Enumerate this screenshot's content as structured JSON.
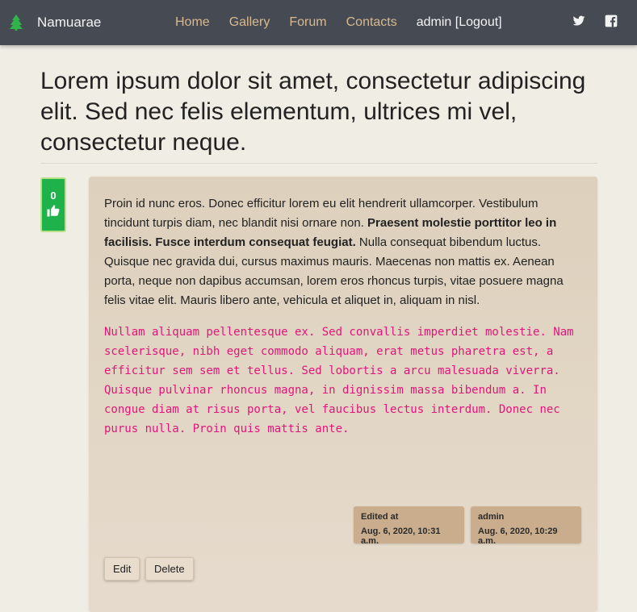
{
  "navbar": {
    "brand": "Namuarae",
    "links": [
      "Home",
      "Gallery",
      "Forum",
      "Contacts"
    ],
    "user_link": "admin [Logout]",
    "socials": [
      "twitter-icon",
      "facebook-icon"
    ],
    "colors": {
      "background": "#464b53",
      "link": "#d8b98f",
      "brand_icon": "#2fb34a"
    }
  },
  "post": {
    "title": "Lorem ipsum dolor sit amet, consectetur adipiscing elit. Sed nec felis elementum, ultrices mi vel, consectetur neque.",
    "votes": "0",
    "body": {
      "text_before_bold": "Proin id nunc eros. Donec efficitur lorem eu elit hendrerit ullamcorper. Vestibulum tincidunt turpis diam, nec blandit nisi ornare non.",
      "bold": "Praesent molestie porttitor leo in facilisis. Fusce interdum consequat feugiat.",
      "text_after_bold": "Nulla consequat bibendum luctus. Quisque nec gravida dui, cursus maximus mauris. Maecenas non mattis ex. Aenean porta, neque non dapibus accumsan, lorem eros rhoncus turpis, vitae posuere magna felis vitae elit. Mauris libero ante, vehicula et aliquet in, aliquam in nisl.",
      "code": "Nullam aliquam pellentesque ex. Sed convallis imperdiet molestie. Nam scelerisque, nibh eget commodo aliquam, erat metus pharetra est, a efficitur sem sem et tellus. Sed lobortis a arcu malesuada viverra. Quisque pulvinar rhoncus magna, in dignissim massa bibendum a. In congue diam at risus porta, vel faucibus lectus interdum. Donec nec purus nulla. Proin quis mattis ante."
    },
    "edited": {
      "label": "Edited at",
      "date": "Aug. 6, 2020, 10:31 a.m."
    },
    "author": {
      "name": "admin",
      "date": "Aug. 6, 2020, 10:29 a.m."
    },
    "actions": {
      "edit": "Edit",
      "delete": "Delete"
    },
    "colors": {
      "vote_bg": "#1fb14a",
      "code": "#e2157a",
      "meta_bg": "#c9ad8d"
    }
  }
}
